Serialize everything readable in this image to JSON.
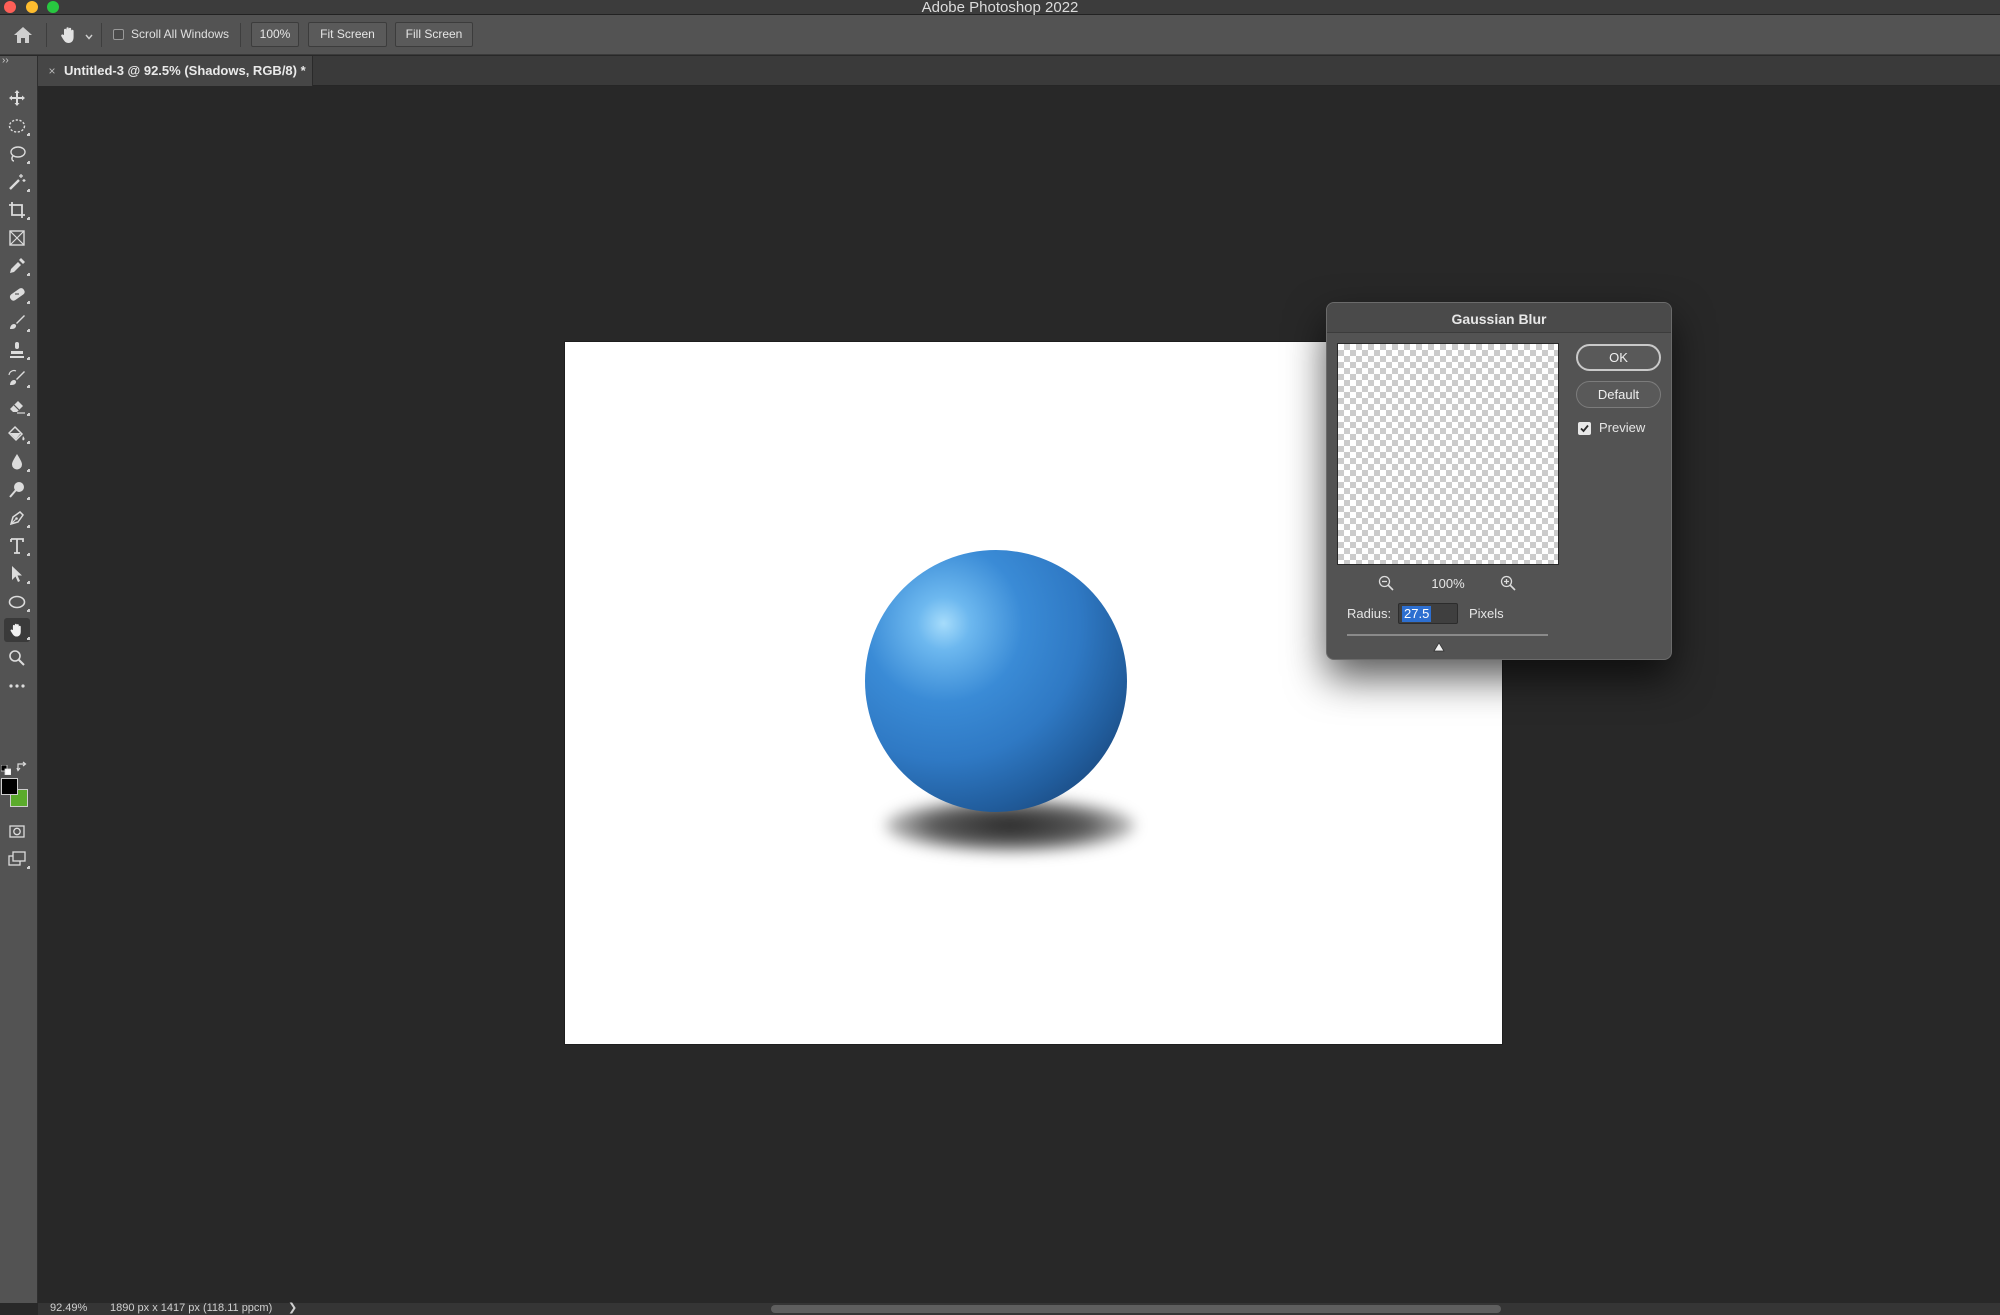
{
  "app": {
    "title": "Adobe Photoshop 2022"
  },
  "options_bar": {
    "scroll_all_windows_label": "Scroll All Windows",
    "scroll_all_windows_checked": false,
    "zoom_button_label": "100%",
    "fit_screen_label": "Fit Screen",
    "fill_screen_label": "Fill Screen"
  },
  "document_tab": {
    "title": "Untitled-3 @ 92.5% (Shadows, RGB/8) *",
    "close_glyph": "×"
  },
  "toolbar": {
    "collapse_glyph": "››",
    "tools": [
      {
        "name": "move-tool",
        "icon": "move-icon"
      },
      {
        "name": "elliptical-marquee-tool",
        "icon": "ellipse-marquee-icon"
      },
      {
        "name": "lasso-tool",
        "icon": "lasso-icon"
      },
      {
        "name": "magic-wand-tool",
        "icon": "magic-wand-icon"
      },
      {
        "name": "crop-tool",
        "icon": "crop-icon"
      },
      {
        "name": "frame-tool",
        "icon": "frame-icon"
      },
      {
        "name": "eyedropper-tool",
        "icon": "eyedropper-icon"
      },
      {
        "name": "healing-brush-tool",
        "icon": "bandage-icon"
      },
      {
        "name": "brush-tool",
        "icon": "brush-icon"
      },
      {
        "name": "clone-stamp-tool",
        "icon": "stamp-icon"
      },
      {
        "name": "history-brush-tool",
        "icon": "history-brush-icon"
      },
      {
        "name": "eraser-tool",
        "icon": "eraser-icon"
      },
      {
        "name": "paint-bucket-tool",
        "icon": "paint-bucket-icon"
      },
      {
        "name": "blur-tool",
        "icon": "drop-icon"
      },
      {
        "name": "dodge-tool",
        "icon": "dodge-icon"
      },
      {
        "name": "pen-tool",
        "icon": "pen-icon"
      },
      {
        "name": "type-tool",
        "icon": "type-icon"
      },
      {
        "name": "path-selection-tool",
        "icon": "arrow-cursor-icon"
      },
      {
        "name": "ellipse-tool",
        "icon": "ellipse-icon"
      },
      {
        "name": "hand-tool",
        "icon": "hand-icon",
        "active": true
      },
      {
        "name": "zoom-tool",
        "icon": "magnifier-icon"
      },
      {
        "name": "edit-toolbar",
        "icon": "more-icon"
      }
    ],
    "foreground_color": "#000000",
    "background_color": "#5bab2c"
  },
  "dialog": {
    "title": "Gaussian Blur",
    "ok_label": "OK",
    "default_label": "Default",
    "preview_label": "Preview",
    "preview_checked": true,
    "preview_zoom": "100%",
    "radius_label": "Radius:",
    "radius_value": "27.5",
    "radius_unit": "Pixels",
    "radius_slider_position": 0.46
  },
  "canvas": {
    "background": "#ffffff",
    "sphere_color": "#2f79c4"
  },
  "status_bar": {
    "zoom": "92.49%",
    "doc_info": "1890 px x 1417 px (118.11 ppcm)",
    "arrow": "❯"
  },
  "colors": {
    "workspace": "#282828",
    "panel": "#535353",
    "selection": "#2d6fd0"
  }
}
